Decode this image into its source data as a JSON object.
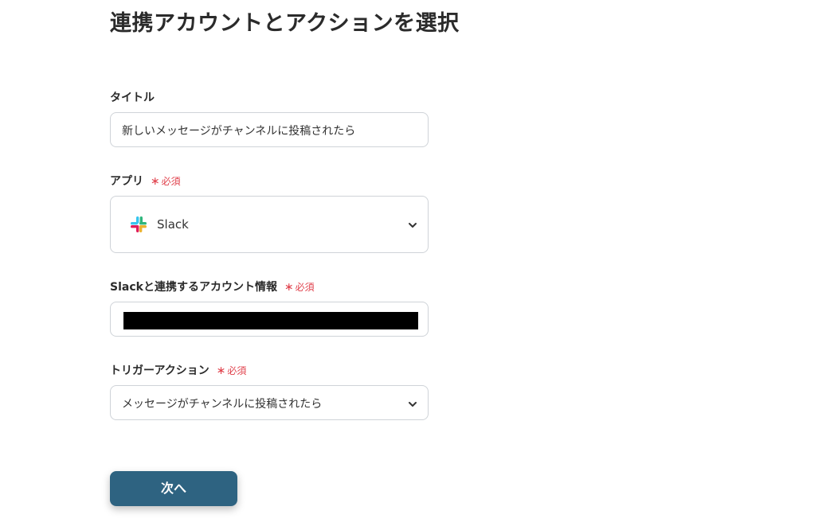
{
  "page": {
    "title": "連携アカウントとアクションを選択"
  },
  "required_marker": {
    "star": "∗",
    "text": "必須"
  },
  "form": {
    "title_field": {
      "label": "タイトル",
      "value": "新しいメッセージがチャンネルに投稿されたら"
    },
    "app_field": {
      "label": "アプリ",
      "value": "Slack",
      "icon": "slack-logo-icon"
    },
    "account_field": {
      "label": "Slackと連携するアカウント情報",
      "value_redacted": true
    },
    "trigger_field": {
      "label": "トリガーアクション",
      "value": "メッセージがチャンネルに投稿されたら"
    }
  },
  "next_button": {
    "label": "次へ"
  },
  "colors": {
    "accent": "#2e6381",
    "required": "#e0414c",
    "border": "#cfd3d8"
  }
}
